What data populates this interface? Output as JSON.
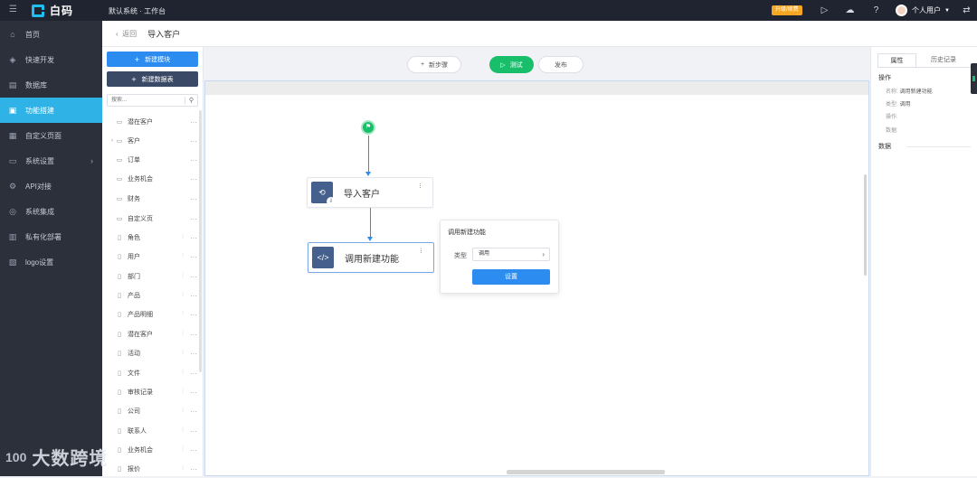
{
  "app": {
    "brand": "白码",
    "window_title": "默认系统 · 工作台",
    "upgrade_badge": "升级/续费",
    "user_name": "个人用户"
  },
  "sidebar": {
    "items": [
      {
        "label": "首页",
        "icon": "home-icon"
      },
      {
        "label": "快速开发",
        "icon": "cube-icon"
      },
      {
        "label": "数据库",
        "icon": "database-icon"
      },
      {
        "label": "功能搭建",
        "icon": "function-icon",
        "active": true
      },
      {
        "label": "自定义页面",
        "icon": "page-icon"
      },
      {
        "label": "系统设置",
        "icon": "monitor-icon"
      },
      {
        "label": "API对接",
        "icon": "api-icon"
      },
      {
        "label": "系统集成",
        "icon": "integration-icon"
      },
      {
        "label": "私有化部署",
        "icon": "server-icon"
      },
      {
        "label": "logo设置",
        "icon": "image-icon"
      }
    ]
  },
  "breadcrumb": {
    "back_label": "返回",
    "current": "导入客户"
  },
  "left_panel": {
    "new_module": "新建模块",
    "new_table": "新建数据表",
    "search_placeholder": "搜索...",
    "tree": [
      {
        "label": "潜在客户",
        "type": "folder"
      },
      {
        "label": "客户",
        "type": "folder",
        "expandable": true
      },
      {
        "label": "订单",
        "type": "folder"
      },
      {
        "label": "业务机会",
        "type": "folder"
      },
      {
        "label": "财务",
        "type": "folder"
      },
      {
        "label": "自定义页",
        "type": "folder"
      },
      {
        "label": "角色",
        "type": "table"
      },
      {
        "label": "用户",
        "type": "table"
      },
      {
        "label": "部门",
        "type": "table"
      },
      {
        "label": "产品",
        "type": "table"
      },
      {
        "label": "产品明细",
        "type": "table"
      },
      {
        "label": "潜在客户",
        "type": "table"
      },
      {
        "label": "活动",
        "type": "table"
      },
      {
        "label": "文件",
        "type": "table"
      },
      {
        "label": "审核记录",
        "type": "table"
      },
      {
        "label": "公司",
        "type": "table"
      },
      {
        "label": "联系人",
        "type": "table"
      },
      {
        "label": "业务机会",
        "type": "table"
      },
      {
        "label": "报价",
        "type": "table"
      }
    ]
  },
  "toolbar": {
    "new_step": "新步骤",
    "test": "测试",
    "publish": "发布"
  },
  "flow": {
    "nodes": [
      {
        "label": "导入客户",
        "icon": "import-icon"
      },
      {
        "label": "调用新建功能",
        "icon": "code-icon",
        "selected": true
      }
    ],
    "popup": {
      "title": "调用新建功能",
      "type_label": "类型",
      "type_value": "调用",
      "button": "设置"
    }
  },
  "right_panel": {
    "tab_props": "属性",
    "tab_history": "历史记录",
    "section_ops": "操作",
    "rows": [
      {
        "key": "名称:",
        "value": "调用新建功能"
      },
      {
        "key": "类型:",
        "value": "调用"
      },
      {
        "key": "操作:",
        "value": ""
      },
      {
        "key": "数据:",
        "value": ""
      }
    ],
    "section_data": "数据"
  },
  "watermark": {
    "logo": "100",
    "text": "大数跨境"
  },
  "colors": {
    "accent": "#2d8cf0",
    "success": "#19be6b",
    "sidebar_active": "#2fb3e6",
    "sidebar_bg": "#2b303b",
    "topbar_bg": "#1f2430"
  }
}
